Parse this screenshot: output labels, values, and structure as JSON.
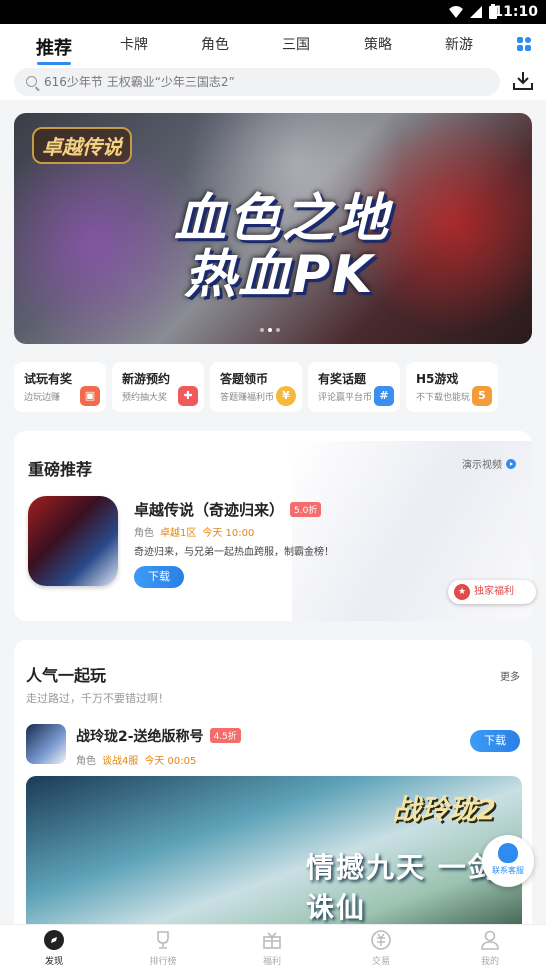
{
  "status_bar": {
    "time": "11:10"
  },
  "header": {
    "tabs": [
      {
        "label": "推荐",
        "active": true
      },
      {
        "label": "卡牌"
      },
      {
        "label": "角色"
      },
      {
        "label": "三国"
      },
      {
        "label": "策略"
      },
      {
        "label": "新游"
      }
    ],
    "search_placeholder": "616少年节 王权霸业“少年三国志2”"
  },
  "banner": {
    "logo_text": "卓越传说",
    "headline_line1": "血色之地",
    "headline_line2": "热血PK"
  },
  "quick_links": [
    {
      "title": "试玩有奖",
      "subtitle": "边玩边赚",
      "icon": "gift-icon",
      "color": "#f26b4f"
    },
    {
      "title": "新游预约",
      "subtitle": "预约抽大奖",
      "icon": "gamepad-icon",
      "color": "#f05a5a"
    },
    {
      "title": "答题领币",
      "subtitle": "答题赚福利币",
      "icon": "coin-icon",
      "color": "#f6b93b"
    },
    {
      "title": "有奖话题",
      "subtitle": "评论赢平台币",
      "icon": "hashtag-icon",
      "color": "#3b8ff0"
    },
    {
      "title": "H5游戏",
      "subtitle": "不下载也能玩",
      "icon": "html5-icon",
      "color": "#f39c3a"
    }
  ],
  "featured": {
    "section_title": "重磅推荐",
    "demo_label": "演示视频",
    "game_name": "卓越传说（奇迹归来）",
    "discount": "5.0折",
    "genre": "角色",
    "server": "卓越1区",
    "open_time": "今天 10:00",
    "description": "奇迹归来，与兄弟一起热血跨服，制霸金榜！",
    "download_label": "下载",
    "exclusive_label": "独家福利"
  },
  "popular": {
    "section_title": "人气一起玩",
    "more_label": "更多",
    "subtitle": "走过路过，千万不要错过啊！",
    "game_name": "战玲珑2-送绝版称号",
    "discount": "4.5折",
    "genre": "角色",
    "server": "谈战4服",
    "open_time": "今天 00:05",
    "download_label": "下载",
    "banner_logo": "战玲珑2",
    "banner_slogan": "情撼九天 一剑诛仙"
  },
  "customer_service": {
    "label": "联系客服"
  },
  "bottom_nav": [
    {
      "label": "发现",
      "icon": "compass-icon",
      "active": true
    },
    {
      "label": "排行榜",
      "icon": "trophy-icon"
    },
    {
      "label": "福利",
      "icon": "gift-box-icon"
    },
    {
      "label": "交易",
      "icon": "exchange-icon"
    },
    {
      "label": "我的",
      "icon": "user-icon"
    }
  ]
}
